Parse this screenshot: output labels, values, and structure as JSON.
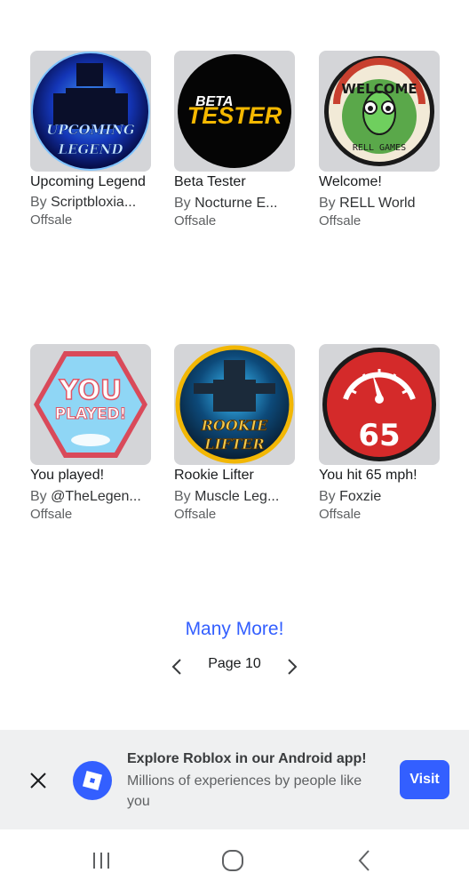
{
  "items": [
    {
      "name": "Upcoming Legend",
      "by": "By",
      "creator": "Scriptbloxia...",
      "price": "Offsale",
      "thumb_text": [
        "UPCOMING",
        "LEGEND"
      ]
    },
    {
      "name": "Beta Tester",
      "by": "By",
      "creator": "Nocturne E...",
      "price": "Offsale",
      "thumb_text": [
        "BETA",
        "TESTER"
      ]
    },
    {
      "name": "Welcome!",
      "by": "By",
      "creator": "RELL World",
      "price": "Offsale",
      "thumb_text": [
        "WELCOME",
        "RELL GAMES"
      ]
    },
    {
      "name": "You played!",
      "by": "By",
      "creator": "@TheLegen...",
      "price": "Offsale",
      "thumb_text": [
        "YOU",
        "PLAYED!"
      ]
    },
    {
      "name": "Rookie Lifter",
      "by": "By",
      "creator": "Muscle Leg...",
      "price": "Offsale",
      "thumb_text": [
        "ROOKIE",
        "LIFTER"
      ]
    },
    {
      "name": "You hit 65 mph!",
      "by": "By",
      "creator": "Foxzie",
      "price": "Offsale",
      "thumb_text": [
        "65"
      ]
    }
  ],
  "more_link": "Many More!",
  "pager": {
    "label": "Page 10"
  },
  "banner": {
    "title": "Explore Roblox in our Android app!",
    "subtitle": "Millions of experiences by people like you",
    "visit_label": "Visit"
  },
  "colors": {
    "accent": "#335fff",
    "banner_bg": "#eff0f1",
    "thumb_bg": "#d4d5d8"
  },
  "icons": [
    "close-icon",
    "roblox-logo-icon",
    "chevron-left-icon",
    "chevron-right-icon",
    "recents-icon",
    "home-icon",
    "back-icon"
  ]
}
